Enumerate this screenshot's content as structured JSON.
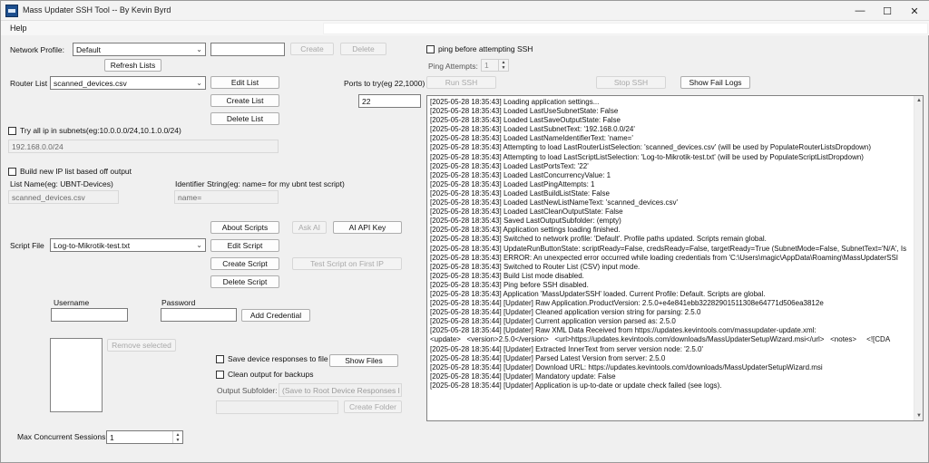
{
  "window": {
    "title": "Mass Updater SSH Tool -- By Kevin Byrd",
    "minimize": "—",
    "maximize": "☐",
    "close": "✕",
    "icon": "app-icon"
  },
  "menu": {
    "help": "Help"
  },
  "network": {
    "label": "Network Profile:",
    "selected": "Default",
    "new_name": "",
    "create": "Create",
    "delete": "Delete",
    "refresh": "Refresh Lists"
  },
  "router": {
    "label": "Router List",
    "selected": "scanned_devices.csv",
    "edit": "Edit List",
    "create": "Create List",
    "delete": "Delete List"
  },
  "ports": {
    "label": "Ports to try(eg 22,1000)",
    "value": "22"
  },
  "ping": {
    "checkbox_label": "ping before attempting SSH",
    "attempts_label": "Ping Attempts:",
    "attempts_value": "1"
  },
  "ssh": {
    "run": "Run SSH",
    "stop": "Stop SSH",
    "fail_logs": "Show Fail Logs"
  },
  "subnet": {
    "checkbox_label": "Try all ip in subnets(eg:10.0.0.0/24,10.1.0.0/24)",
    "value": "192.168.0.0/24"
  },
  "build": {
    "checkbox_label": "Build new IP list based off output",
    "list_name_label": "List Name(eg: UBNT-Devices)",
    "list_name_value": "scanned_devices.csv",
    "identifier_label": "Identifier String(eg: name= for my ubnt test script)",
    "identifier_value": "name="
  },
  "scripts": {
    "about": "About Scripts",
    "ask_ai": "Ask AI",
    "ai_key": "AI API Key",
    "label": "Script File",
    "selected": "Log-to-Mikrotik-test.txt",
    "edit": "Edit Script",
    "create": "Create Script",
    "test": "Test Script on First IP",
    "delete": "Delete Script"
  },
  "credentials": {
    "username_label": "Username",
    "password_label": "Password",
    "username_value": "",
    "password_value": "",
    "add": "Add Credential",
    "remove": "Remove selected"
  },
  "output": {
    "save_label": "Save device responses to file",
    "show_files": "Show Files",
    "clean_label": "Clean output for backups",
    "subfolder_label": "Output Subfolder:",
    "subfolder_value": "(Save to Root Device Responses I",
    "create_folder": "Create Folder"
  },
  "concurrency": {
    "label": "Max Concurrent Sessions",
    "value": "1"
  },
  "log": [
    "[2025-05-28 18:35:43] Loading application settings...",
    "[2025-05-28 18:35:43] Loaded LastUseSubnetState: False",
    "[2025-05-28 18:35:43] Loaded LastSaveOutputState: False",
    "[2025-05-28 18:35:43] Loaded LastSubnetText: '192.168.0.0/24'",
    "[2025-05-28 18:35:43] Loaded LastNameIdentifierText: 'name='",
    "[2025-05-28 18:35:43] Attempting to load LastRouterListSelection: 'scanned_devices.csv' (will be used by PopulateRouterListsDropdown)",
    "[2025-05-28 18:35:43] Attempting to load LastScriptListSelection: 'Log-to-Mikrotik-test.txt' (will be used by PopulateScriptListDropdown)",
    "[2025-05-28 18:35:43] Loaded LastPortsText: '22'",
    "[2025-05-28 18:35:43] Loaded LastConcurrencyValue: 1",
    "[2025-05-28 18:35:43] Loaded LastPingAttempts: 1",
    "[2025-05-28 18:35:43] Loaded LastBuildListState: False",
    "[2025-05-28 18:35:43] Loaded LastNewListNameText: 'scanned_devices.csv'",
    "[2025-05-28 18:35:43] Loaded LastCleanOutputState: False",
    "[2025-05-28 18:35:43] Saved LastOutputSubfolder: (empty)",
    "[2025-05-28 18:35:43] Application settings loading finished.",
    "[2025-05-28 18:35:43] Switched to network profile: 'Default'. Profile paths updated. Scripts remain global.",
    "[2025-05-28 18:35:43] UpdateRunButtonState: scriptReady=False, credsReady=False, targetReady=True (SubnetMode=False, SubnetText='N/A', Is",
    "[2025-05-28 18:35:43] ERROR: An unexpected error occurred while loading credentials from 'C:\\Users\\magic\\AppData\\Roaming\\MassUpdaterSSI",
    "[2025-05-28 18:35:43] Switched to Router List (CSV) input mode.",
    "[2025-05-28 18:35:43] Build List mode disabled.",
    "[2025-05-28 18:35:43] Ping before SSH disabled.",
    "[2025-05-28 18:35:43] Application 'MassUpdaterSSH' loaded. Current Profile: Default. Scripts are global.",
    "[2025-05-28 18:35:44] [Updater] Raw Application.ProductVersion: 2.5.0+e4e841ebb32282901511308e64771d506ea3812e",
    "[2025-05-28 18:35:44] [Updater] Cleaned application version string for parsing: 2.5.0",
    "[2025-05-28 18:35:44] [Updater] Current application version parsed as: 2.5.0",
    "[2025-05-28 18:35:44] [Updater] Raw XML Data Received from https://updates.kevintools.com/massupdater-update.xml:",
    "<update>   <version>2.5.0</version>   <url>https://updates.kevintools.com/downloads/MassUpdaterSetupWizard.msi</url>   <notes>     <![CDA",
    "[2025-05-28 18:35:44] [Updater] Extracted InnerText from server version node: '2.5.0'",
    "[2025-05-28 18:35:44] [Updater] Parsed Latest Version from server: 2.5.0",
    "[2025-05-28 18:35:44] [Updater] Download URL: https://updates.kevintools.com/downloads/MassUpdaterSetupWizard.msi",
    "[2025-05-28 18:35:44] [Updater] Mandatory update: False",
    "[2025-05-28 18:35:44] [Updater] Application is up-to-date or update check failed (see logs)."
  ]
}
